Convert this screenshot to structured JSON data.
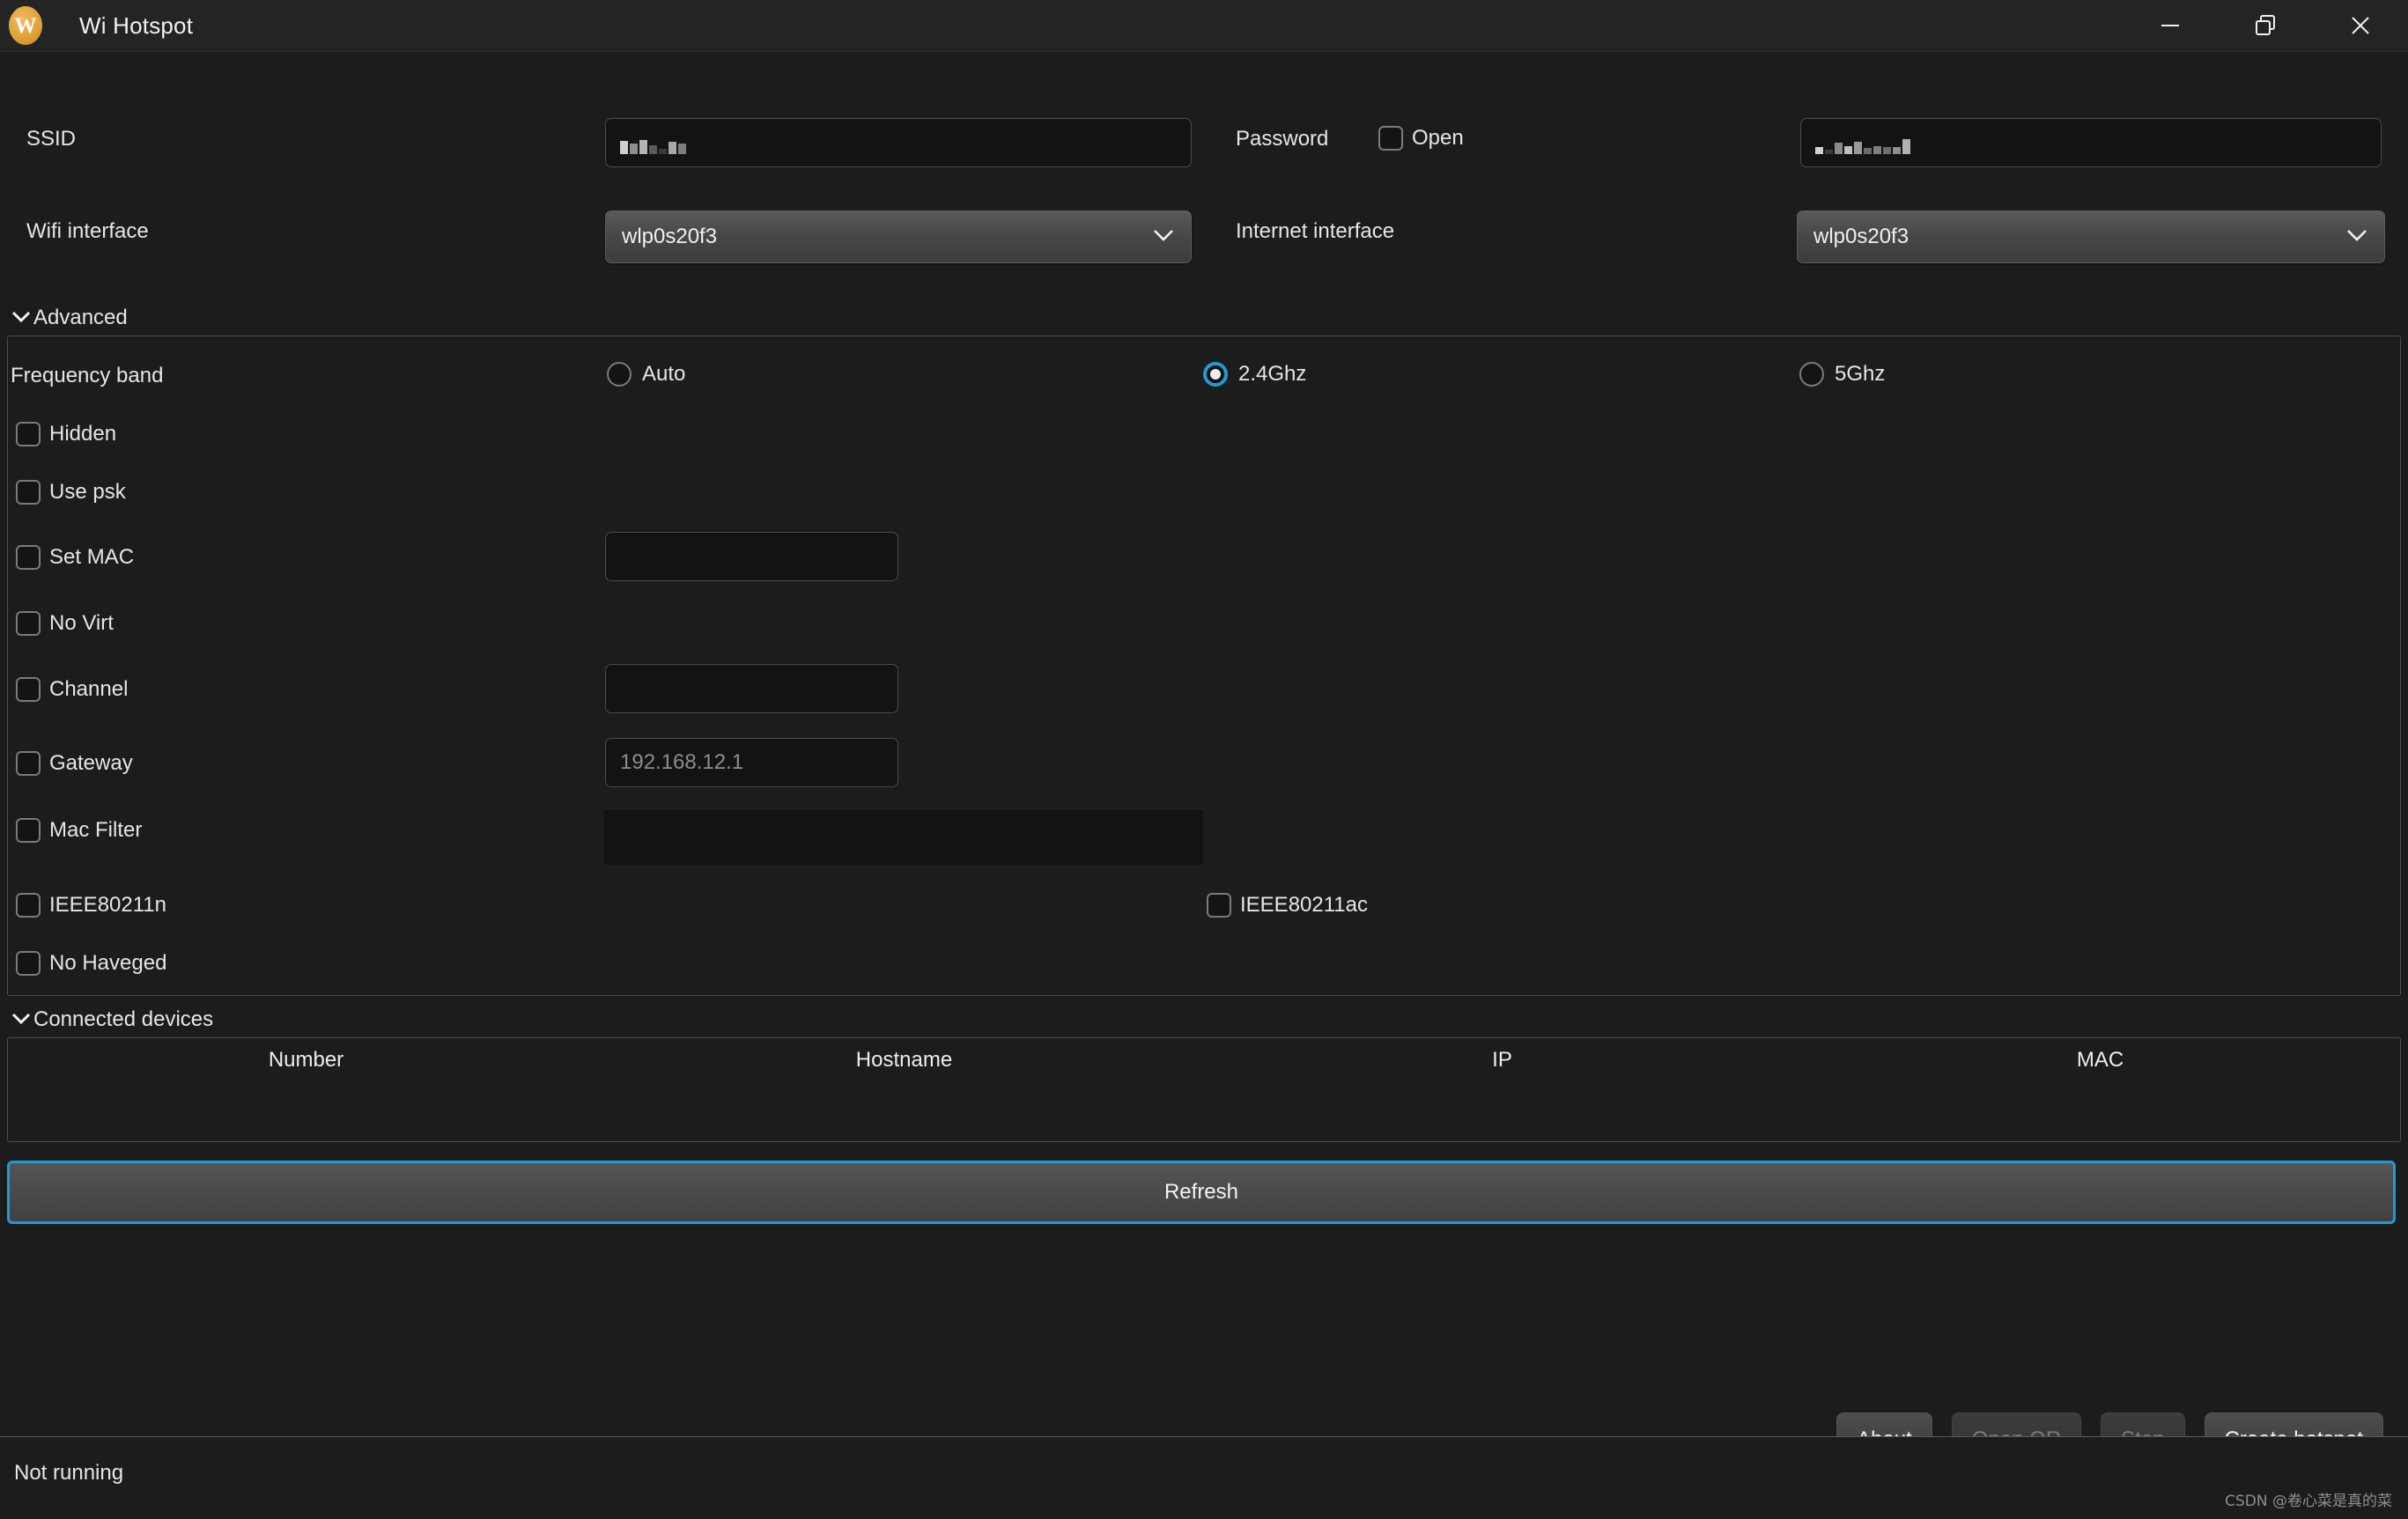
{
  "window": {
    "title": "Wi Hotspot",
    "logo_letter": "W",
    "controls": [
      {
        "name": "minimize",
        "label": "Minimize"
      },
      {
        "name": "restore",
        "label": "Restore"
      },
      {
        "name": "close",
        "label": "Close"
      }
    ]
  },
  "top_form": {
    "ssid_label": "SSID",
    "ssid_value": "",
    "ssid_redacted": true,
    "password_label": "Password",
    "open_label": "Open",
    "open_checked": false,
    "password_value": "",
    "password_redacted": true,
    "wifi_interface_label": "Wifi interface",
    "wifi_interface_value": "wlp0s20f3",
    "internet_interface_label": "Internet interface",
    "internet_interface_value": "wlp0s20f3",
    "chevron": "⌄"
  },
  "advanced": {
    "header": "Advanced",
    "expanded": true,
    "frequency_label": "Frequency band",
    "frequency_options": [
      {
        "label": "Auto",
        "selected": false
      },
      {
        "label": "2.4Ghz",
        "selected": true
      },
      {
        "label": "5Ghz",
        "selected": false
      }
    ],
    "checkboxes": [
      {
        "key": "hidden",
        "label": "Hidden",
        "checked": false
      },
      {
        "key": "use_psk",
        "label": "Use psk",
        "checked": false
      },
      {
        "key": "set_mac",
        "label": "Set MAC",
        "checked": false
      },
      {
        "key": "no_virt",
        "label": "No Virt",
        "checked": false
      },
      {
        "key": "channel",
        "label": "Channel",
        "checked": false
      },
      {
        "key": "gateway",
        "label": "Gateway",
        "checked": false
      },
      {
        "key": "mac_filter",
        "label": "Mac Filter",
        "checked": false
      },
      {
        "key": "ieee80211n",
        "label": "IEEE80211n",
        "checked": false
      },
      {
        "key": "ieee80211ac",
        "label": "IEEE80211ac",
        "checked": false
      },
      {
        "key": "no_haveged",
        "label": "No Haveged",
        "checked": false
      }
    ],
    "set_mac_value": "",
    "channel_value": "",
    "gateway_value": "",
    "gateway_placeholder": "192.168.12.1",
    "mac_filter_value": ""
  },
  "connected_devices": {
    "header": "Connected devices",
    "expanded": true,
    "columns": [
      "Number",
      "Hostname",
      "IP",
      "MAC"
    ],
    "rows": [],
    "refresh_label": "Refresh"
  },
  "footer": {
    "buttons": [
      {
        "key": "about",
        "label": "About",
        "enabled": true
      },
      {
        "key": "open_qr",
        "label": "Open QR",
        "enabled": false
      },
      {
        "key": "stop",
        "label": "Stop",
        "enabled": false
      },
      {
        "key": "create_hotspot",
        "label": "Create hotspot",
        "enabled": true
      }
    ]
  },
  "status": {
    "text": "Not running",
    "watermark": "CSDN @卷心菜是真的菜"
  },
  "colors": {
    "accent": "#1d9bd6",
    "window_bg": "#1c1c1c",
    "titlebar_bg": "#242424",
    "input_bg": "#131313",
    "logo": "#e0a338"
  }
}
